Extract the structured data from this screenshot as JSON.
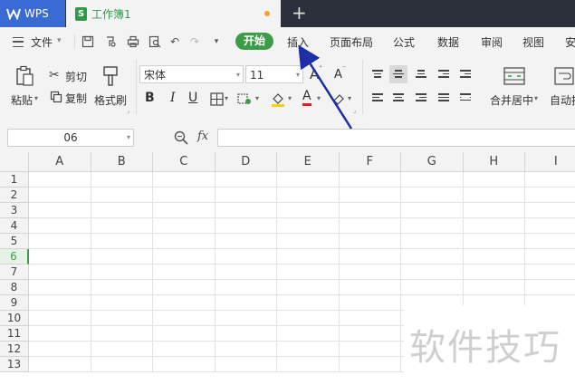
{
  "titlebar": {
    "app_tab": "WPS",
    "doc_tab": "工作簿1",
    "new_tab": "+"
  },
  "menubar": {
    "file": "文件",
    "tabs": [
      "开始",
      "插入",
      "页面布局",
      "公式",
      "数据",
      "审阅",
      "视图",
      "安"
    ]
  },
  "ribbon": {
    "paste": "粘贴",
    "cut": "剪切",
    "copy": "复制",
    "format_painter": "格式刷",
    "font_name": "宋体",
    "font_size": "11",
    "font_grow": "A",
    "font_shrink": "A",
    "bold": "B",
    "italic": "I",
    "underline": "U",
    "font_color": "A",
    "merge_center": "合并居中",
    "auto_wrap": "自动换"
  },
  "formula_bar": {
    "name_box": "06",
    "fx": "fx",
    "value": ""
  },
  "grid": {
    "columns": [
      "A",
      "B",
      "C",
      "D",
      "E",
      "F",
      "G",
      "H",
      "I"
    ],
    "rows": [
      "1",
      "2",
      "3",
      "4",
      "5",
      "6",
      "7",
      "8",
      "9",
      "10",
      "11",
      "12",
      "13"
    ],
    "selected_row": "6"
  },
  "watermark": "软件技巧",
  "colors": {
    "accent_green": "#3d9c4a",
    "wps_blue": "#3a6ad4",
    "arrow_blue": "#1c2ea8"
  }
}
